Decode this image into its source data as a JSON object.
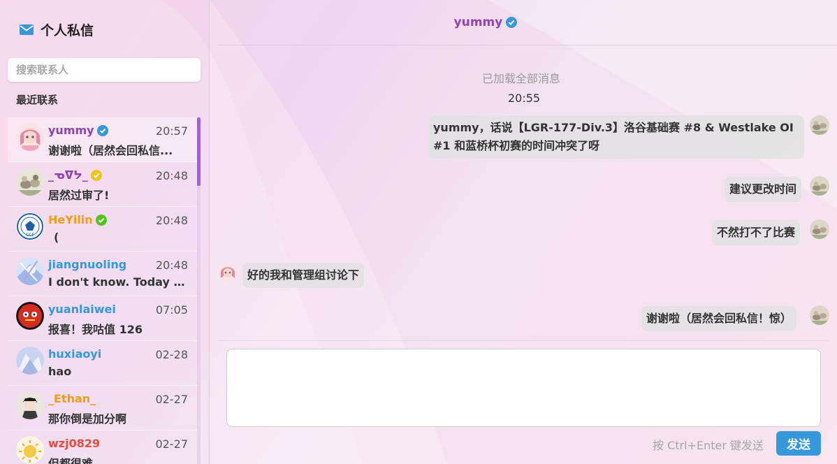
{
  "sidebar": {
    "title": "个人私信",
    "search_placeholder": "搜索联系人",
    "recent_label": "最近联系",
    "contacts": [
      {
        "name": "yummy",
        "name_color": "#8e44ad",
        "badge": "verified-blue",
        "time": "20:57",
        "last_message": "谢谢啦（居然会回私信...",
        "active": true
      },
      {
        "name": "_ᓀᐁᔭ_",
        "name_color": "#8e44ad",
        "badge": "verified-gold",
        "time": "20:48",
        "last_message": "居然过审了!"
      },
      {
        "name": "HeYilin",
        "name_color": "#f39c12",
        "badge": "verified-green",
        "time": "20:48",
        "last_message": "("
      },
      {
        "name": "jiangnuoling",
        "name_color": "#3498db",
        "badge": "",
        "time": "20:48",
        "last_message": "I don't know. Today I ..."
      },
      {
        "name": "yuanlaiwei",
        "name_color": "#3498db",
        "badge": "",
        "time": "07:05",
        "last_message": "报喜！我咕值 126"
      },
      {
        "name": "huxiaoyi",
        "name_color": "#3498db",
        "badge": "",
        "time": "02-28",
        "last_message": "hao"
      },
      {
        "name": "_Ethan_",
        "name_color": "#f39c12",
        "badge": "",
        "time": "02-27",
        "last_message": "那你倒是加分啊"
      },
      {
        "name": "wzj0829",
        "name_color": "#e74c3c",
        "badge": "",
        "time": "02-27",
        "last_message": "但都很难"
      }
    ]
  },
  "chat": {
    "partner_name": "yummy",
    "loaded_all_text": "已加载全部消息",
    "time_separator": "20:55",
    "messages": [
      {
        "side": "right",
        "text": "yummy，话说【LGR-177-Div.3】洛谷基础赛 #8 & Westlake OI #1 和蓝桥杯初赛的时间冲突了呀"
      },
      {
        "side": "right",
        "text": "建议更改时间"
      },
      {
        "side": "right",
        "text": "不然打不了比赛"
      },
      {
        "side": "left",
        "text": "好的我和管理组讨论下"
      },
      {
        "side": "right",
        "text": "谢谢啦（居然会回私信！惊）"
      }
    ],
    "input_placeholder": "",
    "hint": "按 Ctrl+Enter 键发送",
    "send_label": "发送"
  },
  "colors": {
    "accent_purple": "#8e44ad",
    "send_button": "#3498db",
    "scroll_thumb": "#9b63d7"
  },
  "icons": {
    "title": "mail-icon",
    "verified": "check-badge-icon"
  }
}
